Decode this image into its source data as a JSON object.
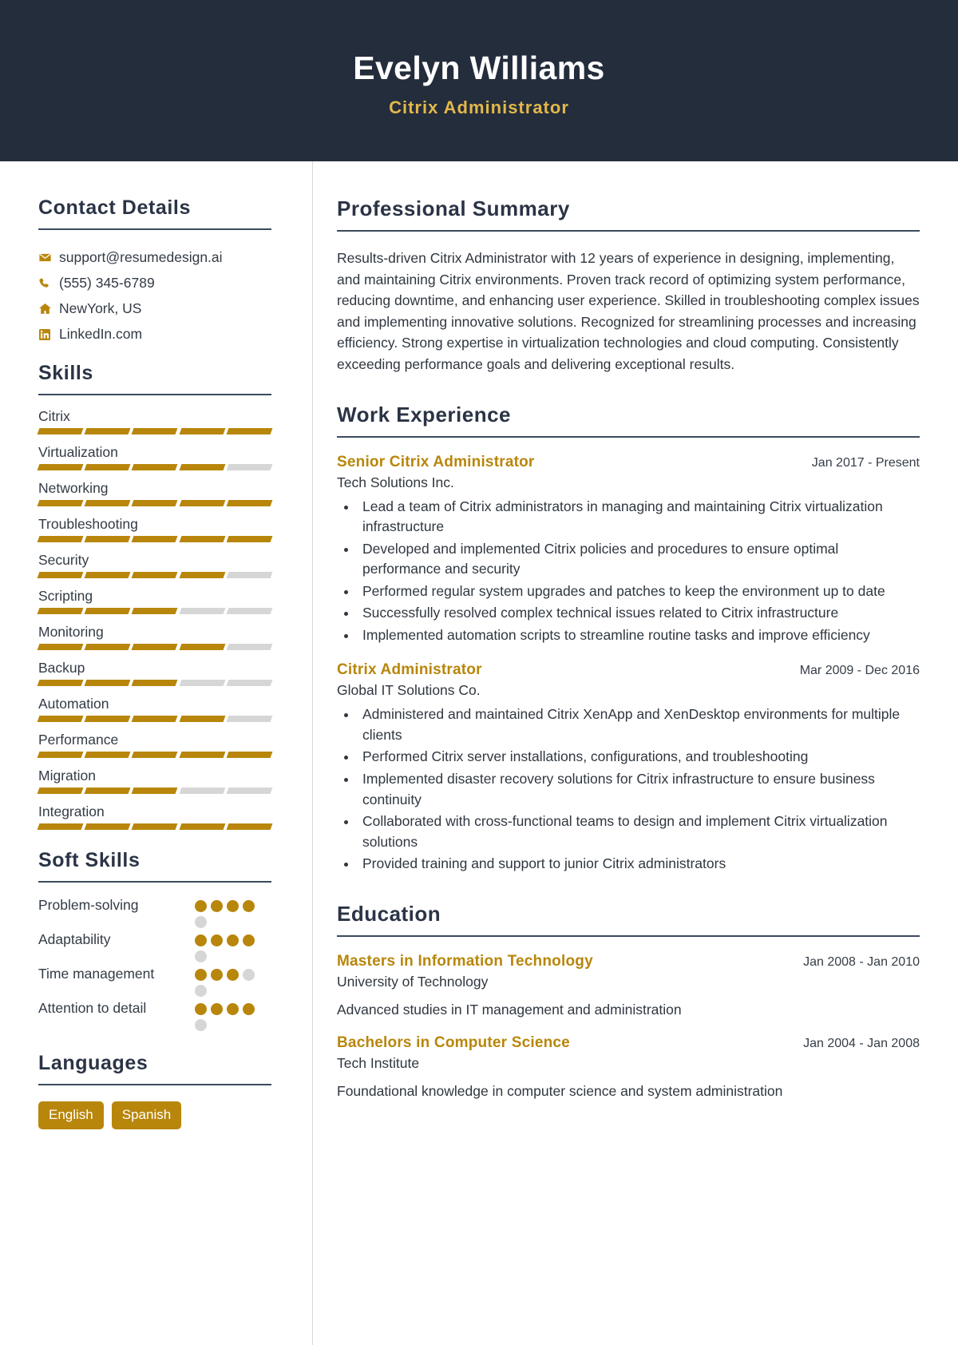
{
  "header": {
    "name": "Evelyn Williams",
    "role": "Citrix Administrator",
    "bg_color": "#242d3c",
    "accent_color": "#e3b84a"
  },
  "theme": {
    "gold": "#b8860b",
    "navy": "#2b3446",
    "muted": "#d6d6d6"
  },
  "sidebar": {
    "contact": {
      "title": "Contact Details",
      "items": [
        {
          "icon": "envelope-icon",
          "text": "support@resumedesign.ai"
        },
        {
          "icon": "phone-icon",
          "text": "(555) 345-6789"
        },
        {
          "icon": "home-icon",
          "text": "NewYork, US"
        },
        {
          "icon": "linkedin-icon",
          "text": "LinkedIn.com"
        }
      ]
    },
    "skills": {
      "title": "Skills",
      "max": 5,
      "items": [
        {
          "name": "Citrix",
          "level": 5
        },
        {
          "name": "Virtualization",
          "level": 4
        },
        {
          "name": "Networking",
          "level": 5
        },
        {
          "name": "Troubleshooting",
          "level": 5
        },
        {
          "name": "Security",
          "level": 4
        },
        {
          "name": "Scripting",
          "level": 3
        },
        {
          "name": "Monitoring",
          "level": 4
        },
        {
          "name": "Backup",
          "level": 3
        },
        {
          "name": "Automation",
          "level": 4
        },
        {
          "name": "Performance",
          "level": 5
        },
        {
          "name": "Migration",
          "level": 3
        },
        {
          "name": "Integration",
          "level": 5
        }
      ]
    },
    "soft_skills": {
      "title": "Soft Skills",
      "max": 5,
      "items": [
        {
          "name": "Problem-solving",
          "level": 4
        },
        {
          "name": "Adaptability",
          "level": 4
        },
        {
          "name": "Time management",
          "level": 3
        },
        {
          "name": "Attention to detail",
          "level": 4
        }
      ]
    },
    "languages": {
      "title": "Languages",
      "items": [
        "English",
        "Spanish"
      ]
    }
  },
  "main": {
    "summary": {
      "title": "Professional Summary",
      "text": "Results-driven Citrix Administrator with 12 years of experience in designing, implementing, and maintaining Citrix environments. Proven track record of optimizing system performance, reducing downtime, and enhancing user experience. Skilled in troubleshooting complex issues and implementing innovative solutions. Recognized for streamlining processes and increasing efficiency. Strong expertise in virtualization technologies and cloud computing. Consistently exceeding performance goals and delivering exceptional results."
    },
    "work": {
      "title": "Work Experience",
      "entries": [
        {
          "title": "Senior Citrix Administrator",
          "company": "Tech Solutions Inc.",
          "date": "Jan 2017 - Present",
          "bullets": [
            "Lead a team of Citrix administrators in managing and maintaining Citrix virtualization infrastructure",
            "Developed and implemented Citrix policies and procedures to ensure optimal performance and security",
            "Performed regular system upgrades and patches to keep the environment up to date",
            "Successfully resolved complex technical issues related to Citrix infrastructure",
            "Implemented automation scripts to streamline routine tasks and improve efficiency"
          ]
        },
        {
          "title": "Citrix Administrator",
          "company": "Global IT Solutions Co.",
          "date": "Mar 2009 - Dec 2016",
          "bullets": [
            "Administered and maintained Citrix XenApp and XenDesktop environments for multiple clients",
            "Performed Citrix server installations, configurations, and troubleshooting",
            "Implemented disaster recovery solutions for Citrix infrastructure to ensure business continuity",
            "Collaborated with cross-functional teams to design and implement Citrix virtualization solutions",
            "Provided training and support to junior Citrix administrators"
          ]
        }
      ]
    },
    "education": {
      "title": "Education",
      "entries": [
        {
          "title": "Masters in Information Technology",
          "school": "University of Technology",
          "date": "Jan 2008 - Jan 2010",
          "description": "Advanced studies in IT management and administration"
        },
        {
          "title": "Bachelors in Computer Science",
          "school": "Tech Institute",
          "date": "Jan 2004 - Jan 2008",
          "description": "Foundational knowledge in computer science and system administration"
        }
      ]
    }
  }
}
